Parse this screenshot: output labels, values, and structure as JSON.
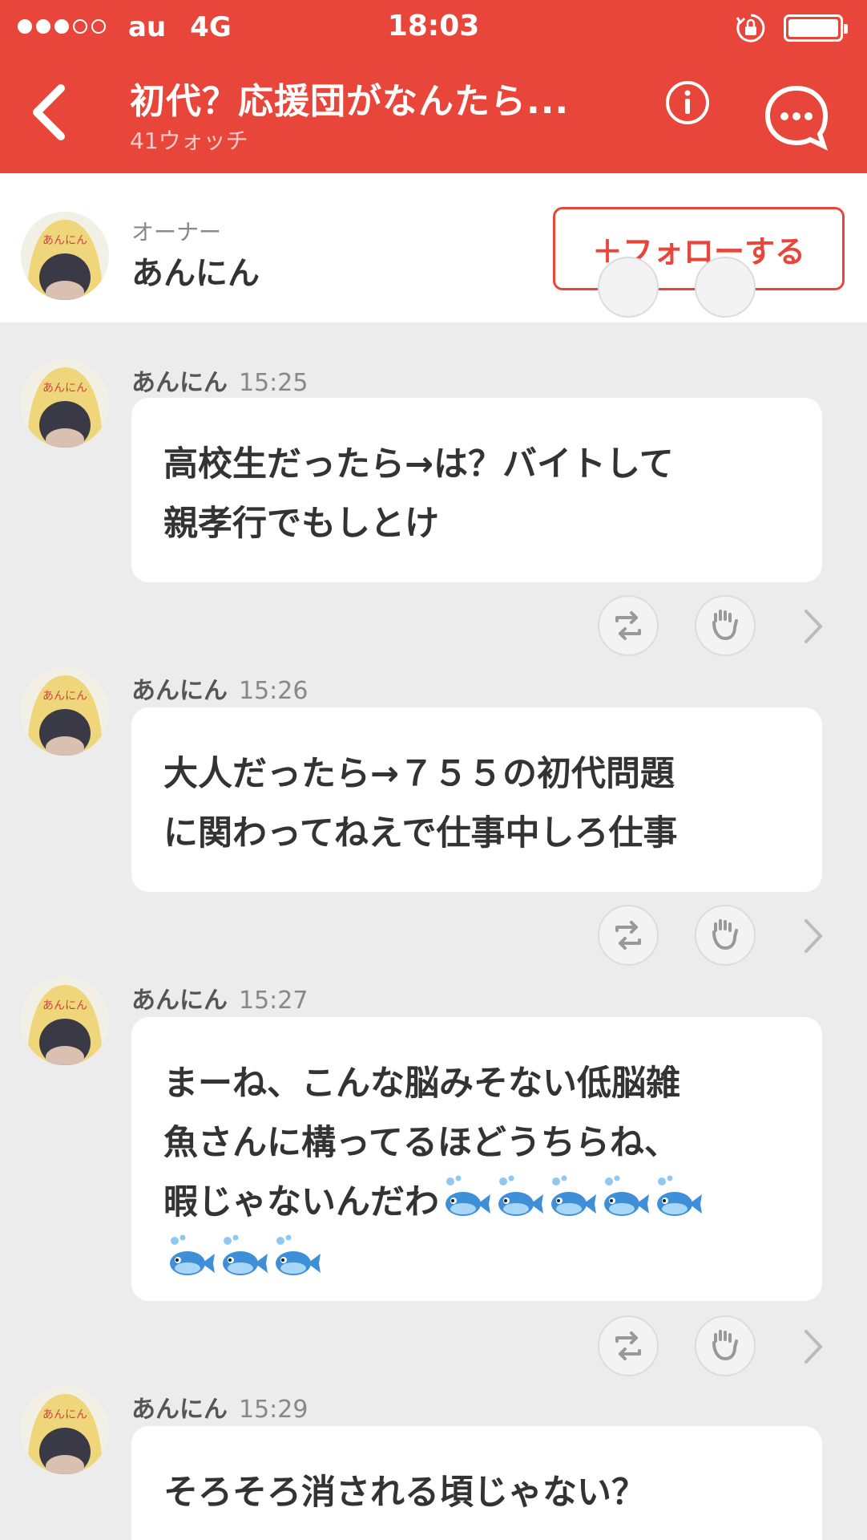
{
  "colors": {
    "accent": "#e8453b",
    "background": "#ececec"
  },
  "status_bar": {
    "carrier": "au",
    "network": "4G",
    "time": "18:03"
  },
  "header": {
    "title": "初代？応援団がなんたら...",
    "watch_count": "41ウォッチ",
    "back_icon": "chevron-left-icon",
    "info_icon": "info-icon",
    "chat_icon": "chat-bubble-icon"
  },
  "owner": {
    "label": "オーナー",
    "name": "あんにん",
    "follow_label": "＋フォローする"
  },
  "messages": [
    {
      "user": "あんにん",
      "time": "15:25",
      "lines": [
        "高校生だったら→は？バイトして",
        "親孝行でもしとけ"
      ]
    },
    {
      "user": "あんにん",
      "time": "15:26",
      "lines": [
        "大人だったら→７５５の初代問題",
        "に関わってねえで仕事中しろ仕事"
      ]
    },
    {
      "user": "あんにん",
      "time": "15:27",
      "lines": [
        "まーね、こんな脳みそない低脳雑",
        "魚さんに構ってるほどうちらね、",
        "暇じゃないんだわ"
      ],
      "emoji": "fish-icon",
      "emoji_row1_count": 5,
      "emoji_row2_count": 3
    },
    {
      "user": "あんにん",
      "time": "15:29",
      "lines": [
        "そろそろ消される頃じゃない？"
      ]
    }
  ]
}
